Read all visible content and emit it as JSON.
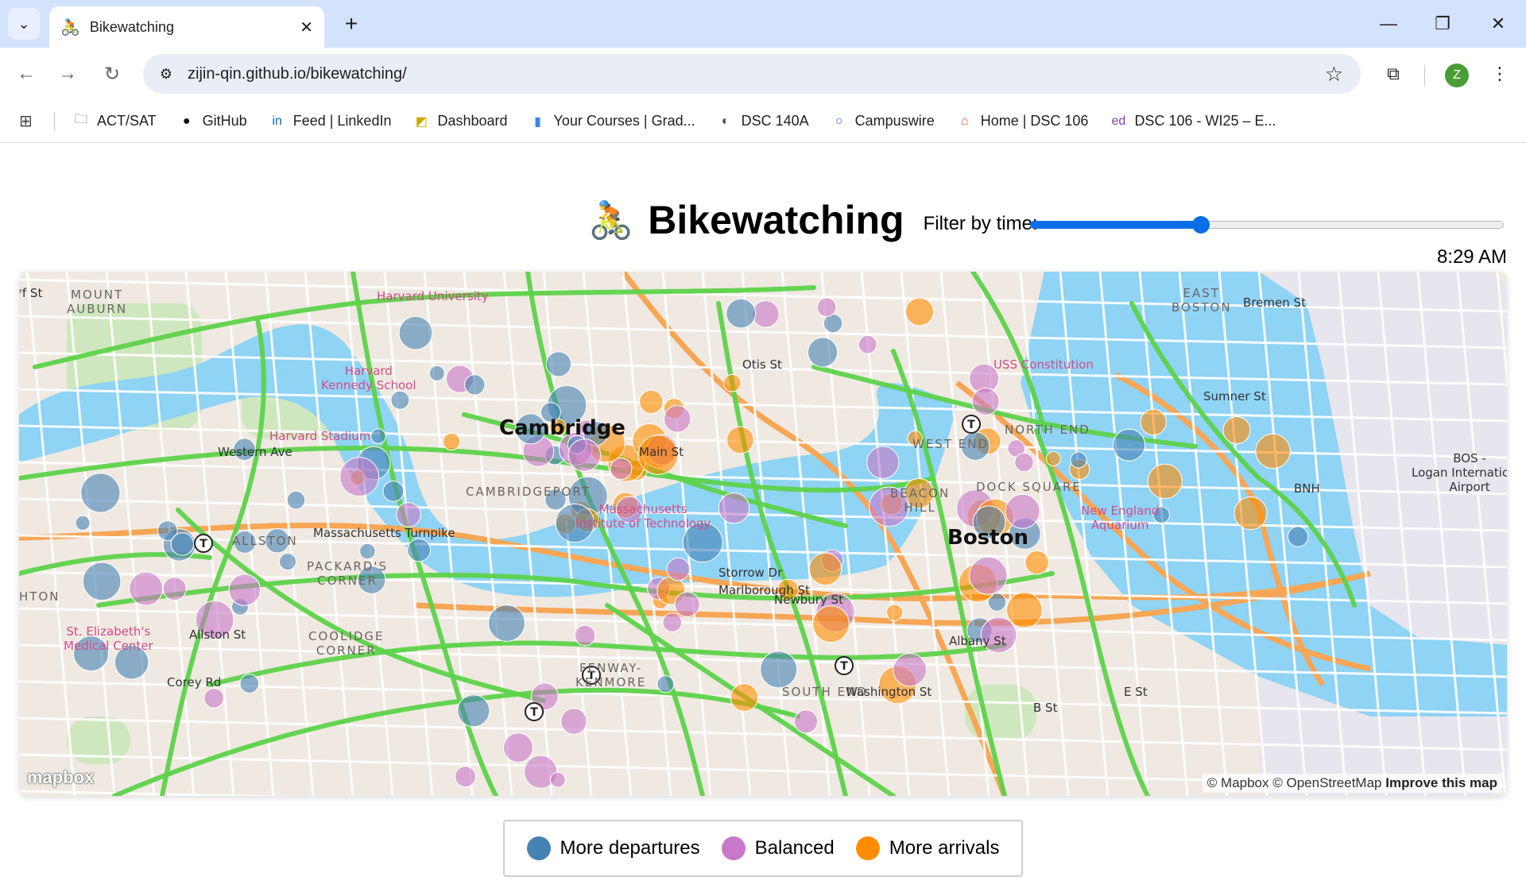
{
  "browser": {
    "tab_title": "Bikewatching",
    "tab_favicon": "🚴",
    "url": "zijin-qin.github.io/bikewatching/",
    "profile_initial": "Z",
    "bookmarks": [
      {
        "label": "ACT/SAT",
        "icon": "folder-icon",
        "glyph": "🗀",
        "color": "#444"
      },
      {
        "label": "GitHub",
        "icon": "github-icon",
        "glyph": "●",
        "color": "#111"
      },
      {
        "label": "Feed | LinkedIn",
        "icon": "linkedin-icon",
        "glyph": "in",
        "color": "#0a66c2"
      },
      {
        "label": "Dashboard",
        "icon": "dashboard-icon",
        "glyph": "◩",
        "color": "#c9a800"
      },
      {
        "label": "Your Courses | Grad...",
        "icon": "gradescope-icon",
        "glyph": "▮",
        "color": "#3b82f6"
      },
      {
        "label": "DSC 140A",
        "icon": "globe-icon",
        "glyph": "◐",
        "color": "#444"
      },
      {
        "label": "Campuswire",
        "icon": "campuswire-icon",
        "glyph": "○",
        "color": "#2563eb"
      },
      {
        "label": "Home | DSC 106",
        "icon": "home-icon",
        "glyph": "⌂",
        "color": "#e05a2b"
      },
      {
        "label": "DSC 106 - WI25 – E...",
        "icon": "ed-icon",
        "glyph": "ed",
        "color": "#7b3fb5"
      }
    ]
  },
  "page": {
    "logo": "🚴",
    "title": "Bikewatching",
    "filter_label": "Filter by time:",
    "slider_value": 0.36,
    "time_display": "8:29 AM"
  },
  "map": {
    "labels": {
      "mount_auburn": "MOUNT\nAUBURN",
      "harvard_university": "Harvard University",
      "harvard_kennedy": "Harvard\nKennedy School",
      "harvard_stadium": "Harvard Stadium",
      "cambridge": "Cambridge",
      "western_ave": "Western Ave",
      "cambridgeport": "CAMBRIDGEPORT",
      "mit": "Massachusetts\nInstitute of Technology",
      "allston": "ALLSTON",
      "mass_turnpike": "Massachusetts Turnpike",
      "packards_corner": "PACKARD'S\nCORNER",
      "brighton": "HTON",
      "st_elizabeths": "St. Elizabeth's\nMedical Center",
      "allston_st": "Allston St",
      "corey_rd": "Corey Rd",
      "coolidge_corner": "COOLIDGE\nCORNER",
      "fenway": "FENWAY-\nKENMORE",
      "otis_st": "Otis St",
      "main_st": "Main St",
      "storrow_dr": "Storrow Dr",
      "marlborough_st": "Marlborough St",
      "newbury_st": "Newbury St",
      "beacon_hill": "BEACON\nHILL",
      "west_end": "WEST END",
      "north_end": "NORTH END",
      "dock_square": "DOCK SQUARE",
      "boston": "Boston",
      "new_england_aquarium": "New England\nAquarium",
      "uss_constitution": "USS Constitution",
      "east_boston": "EAST\nBOSTON",
      "bremen_st": "Bremen St",
      "sumner_st": "Sumner St",
      "south_end": "SOUTH END",
      "washington_st": "Washington St",
      "albany_st": "Albany St",
      "b_st": "B St",
      "e_st": "E St",
      "bnh": "BNH",
      "bos_airport": "BOS -\nLogan International\nAirport",
      "west_st": "ʳf St"
    },
    "mapbox_logo": "mapbox",
    "attribution_prefix": "© Mapbox © OpenStreetMap",
    "attribution_link": "Improve this map",
    "colors": {
      "departures": "#4682b4",
      "balanced": "#c878c8",
      "arrivals": "#ff8c00",
      "water": "#8fd3f5",
      "bikelane": "#5dd24a",
      "highway": "#f7a655",
      "land": "#efe9e1",
      "park": "#c7e6b5"
    },
    "stations": [
      {
        "r": 0.5,
        "t": "d"
      },
      {
        "r": 0.6,
        "t": "b"
      },
      {
        "r": 1.0,
        "t": "a"
      },
      {
        "r": 0.9,
        "t": "a"
      },
      {
        "r": 1.3,
        "t": "d"
      },
      {
        "r": 0.9,
        "t": "b"
      },
      {
        "r": 1.6,
        "t": "b"
      },
      {
        "r": 1.2,
        "t": "d"
      },
      {
        "r": 1.6,
        "t": "d"
      },
      {
        "r": 1.4,
        "t": "d"
      },
      {
        "r": 1.2,
        "t": "d"
      },
      {
        "r": 0.9,
        "t": "b"
      }
    ]
  },
  "legend": {
    "departures": "More departures",
    "balanced": "Balanced",
    "arrivals": "More arrivals"
  }
}
